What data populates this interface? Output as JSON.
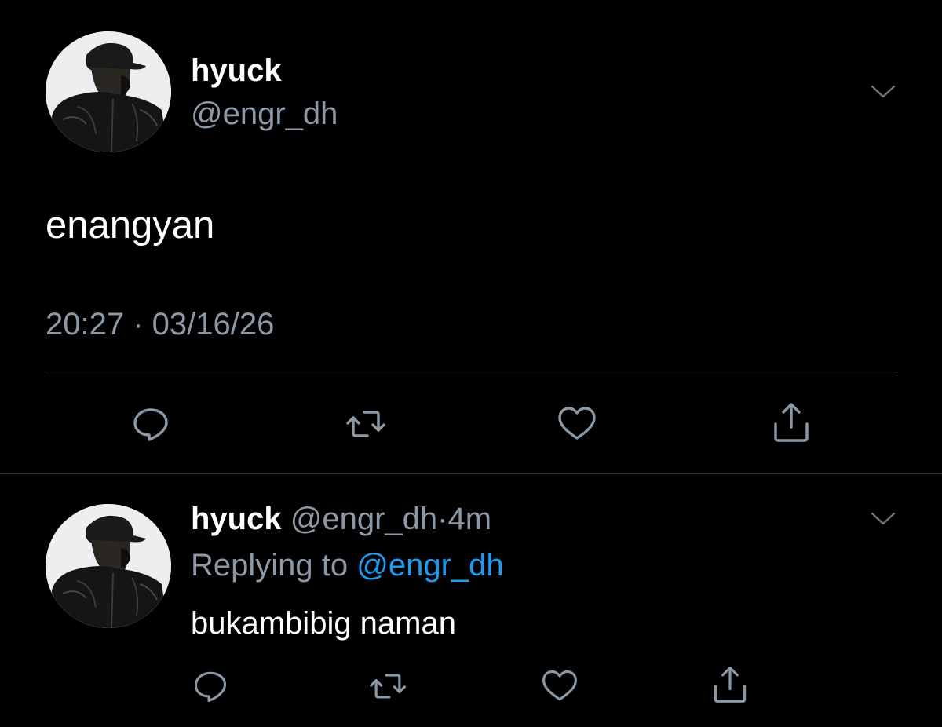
{
  "main_tweet": {
    "author_name": "hyuck",
    "author_handle": "@engr_dh",
    "text": "enangyan",
    "timestamp": "20:27 · 03/16/26",
    "avatar_icon": "profile-photo-person-in-cap-and-leather-jacket"
  },
  "reply_tweet": {
    "author_name": "hyuck",
    "author_handle": "@engr_dh",
    "separator": "·",
    "age": "4m",
    "replying_to_prefix": "Replying to",
    "replying_to_handle": "@engr_dh",
    "text": "bukambibig naman",
    "avatar_icon": "profile-photo-person-in-cap-and-leather-jacket"
  },
  "actions": {
    "icons": [
      "reply-icon",
      "retweet-icon",
      "like-icon",
      "share-icon"
    ]
  },
  "colors": {
    "background": "#000000",
    "primary_text": "#ffffff",
    "secondary_text": "#8b98a5",
    "link": "#1d9bf0",
    "divider": "#2f3336"
  }
}
